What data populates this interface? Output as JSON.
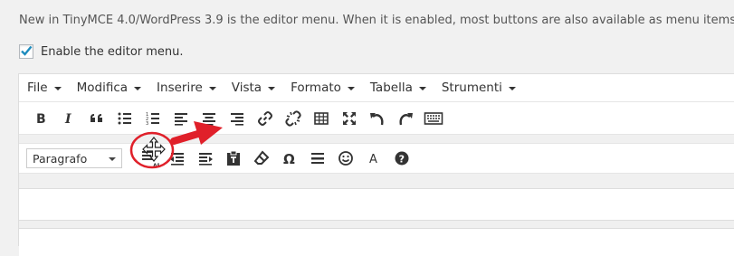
{
  "description": "New in TinyMCE 4.0/WordPress 3.9 is the editor menu. When it is enabled, most buttons are also available as menu items.",
  "enable_checkbox": {
    "label": "Enable the editor menu.",
    "checked": true
  },
  "menu": [
    {
      "label": "File"
    },
    {
      "label": "Modifica"
    },
    {
      "label": "Inserire"
    },
    {
      "label": "Vista"
    },
    {
      "label": "Formato"
    },
    {
      "label": "Tabella"
    },
    {
      "label": "Strumenti"
    }
  ],
  "toolbar1_icons": [
    "bold-icon",
    "italic-icon",
    "blockquote-icon",
    "bullet-list-icon",
    "numbered-list-icon",
    "align-left-icon",
    "align-center-icon",
    "align-right-icon",
    "link-icon",
    "unlink-icon",
    "table-icon",
    "fullscreen-icon",
    "undo-icon",
    "redo-icon",
    "keyboard-icon"
  ],
  "toolbar2": {
    "format_select_value": "Paragrafo",
    "icons": [
      "strikethrough-icon",
      "outdent-icon",
      "indent-icon",
      "paste-text-icon",
      "clear-formatting-icon",
      "special-character-icon",
      "horizontal-rule-icon",
      "emoticons-icon",
      "text-color-icon",
      "help-icon"
    ]
  },
  "colors": {
    "annotation": "#e0202a",
    "icon": "#333333",
    "background": "#f1f1f1"
  }
}
